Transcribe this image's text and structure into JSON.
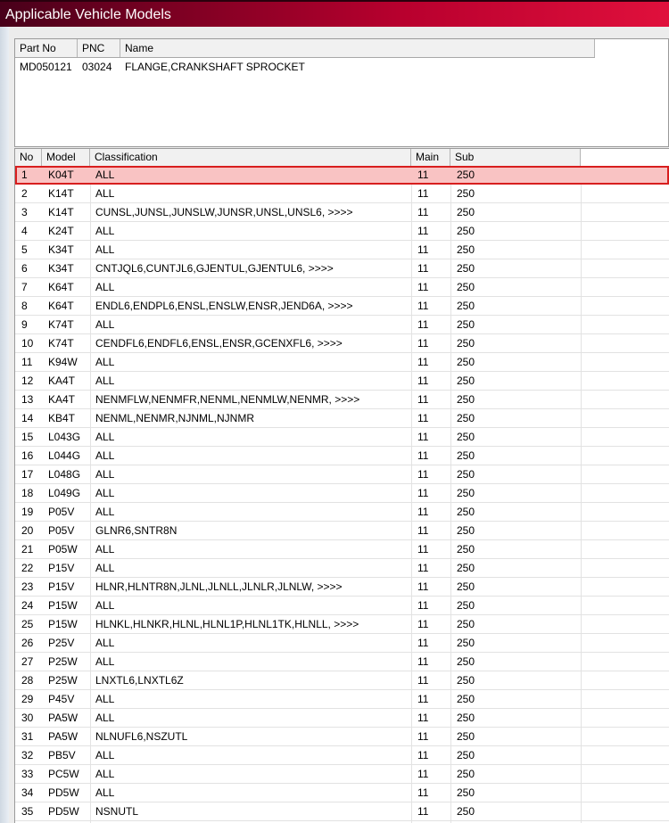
{
  "window": {
    "title": "Applicable Vehicle Models"
  },
  "part": {
    "headers": {
      "part_no": "Part No",
      "pnc": "PNC",
      "name": "Name"
    },
    "row": {
      "part_no": "MD050121",
      "pnc": "03024",
      "name": "FLANGE,CRANKSHAFT SPROCKET"
    }
  },
  "models": {
    "headers": {
      "no": "No",
      "model": "Model",
      "classification": "Classification",
      "main": "Main",
      "sub": "Sub"
    },
    "selected_index": 0,
    "rows": [
      {
        "no": "1",
        "model": "K04T",
        "classification": "ALL",
        "main": "11",
        "sub": "250"
      },
      {
        "no": "2",
        "model": "K14T",
        "classification": "ALL",
        "main": "11",
        "sub": "250"
      },
      {
        "no": "3",
        "model": "K14T",
        "classification": "CUNSL,JUNSL,JUNSLW,JUNSR,UNSL,UNSL6,  >>>>",
        "main": "11",
        "sub": "250"
      },
      {
        "no": "4",
        "model": "K24T",
        "classification": "ALL",
        "main": "11",
        "sub": "250"
      },
      {
        "no": "5",
        "model": "K34T",
        "classification": "ALL",
        "main": "11",
        "sub": "250"
      },
      {
        "no": "6",
        "model": "K34T",
        "classification": "CNTJQL6,CUNTJL6,GJENTUL,GJENTUL6,  >>>>",
        "main": "11",
        "sub": "250"
      },
      {
        "no": "7",
        "model": "K64T",
        "classification": "ALL",
        "main": "11",
        "sub": "250"
      },
      {
        "no": "8",
        "model": "K64T",
        "classification": "ENDL6,ENDPL6,ENSL,ENSLW,ENSR,JEND6A,  >>>>",
        "main": "11",
        "sub": "250"
      },
      {
        "no": "9",
        "model": "K74T",
        "classification": "ALL",
        "main": "11",
        "sub": "250"
      },
      {
        "no": "10",
        "model": "K74T",
        "classification": "CENDFL6,ENDFL6,ENSL,ENSR,GCENXFL6,  >>>>",
        "main": "11",
        "sub": "250"
      },
      {
        "no": "11",
        "model": "K94W",
        "classification": "ALL",
        "main": "11",
        "sub": "250"
      },
      {
        "no": "12",
        "model": "KA4T",
        "classification": "ALL",
        "main": "11",
        "sub": "250"
      },
      {
        "no": "13",
        "model": "KA4T",
        "classification": "NENMFLW,NENMFR,NENML,NENMLW,NENMR,  >>>>",
        "main": "11",
        "sub": "250"
      },
      {
        "no": "14",
        "model": "KB4T",
        "classification": "NENML,NENMR,NJNML,NJNMR",
        "main": "11",
        "sub": "250"
      },
      {
        "no": "15",
        "model": "L043G",
        "classification": "ALL",
        "main": "11",
        "sub": "250"
      },
      {
        "no": "16",
        "model": "L044G",
        "classification": "ALL",
        "main": "11",
        "sub": "250"
      },
      {
        "no": "17",
        "model": "L048G",
        "classification": "ALL",
        "main": "11",
        "sub": "250"
      },
      {
        "no": "18",
        "model": "L049G",
        "classification": "ALL",
        "main": "11",
        "sub": "250"
      },
      {
        "no": "19",
        "model": "P05V",
        "classification": "ALL",
        "main": "11",
        "sub": "250"
      },
      {
        "no": "20",
        "model": "P05V",
        "classification": "GLNR6,SNTR8N",
        "main": "11",
        "sub": "250"
      },
      {
        "no": "21",
        "model": "P05W",
        "classification": "ALL",
        "main": "11",
        "sub": "250"
      },
      {
        "no": "22",
        "model": "P15V",
        "classification": "ALL",
        "main": "11",
        "sub": "250"
      },
      {
        "no": "23",
        "model": "P15V",
        "classification": "HLNR,HLNTR8N,JLNL,JLNLL,JLNLR,JLNLW,  >>>>",
        "main": "11",
        "sub": "250"
      },
      {
        "no": "24",
        "model": "P15W",
        "classification": "ALL",
        "main": "11",
        "sub": "250"
      },
      {
        "no": "25",
        "model": "P15W",
        "classification": "HLNKL,HLNKR,HLNL,HLNL1P,HLNL1TK,HLNLL,  >>>>",
        "main": "11",
        "sub": "250"
      },
      {
        "no": "26",
        "model": "P25V",
        "classification": "ALL",
        "main": "11",
        "sub": "250"
      },
      {
        "no": "27",
        "model": "P25W",
        "classification": "ALL",
        "main": "11",
        "sub": "250"
      },
      {
        "no": "28",
        "model": "P25W",
        "classification": "LNXTL6,LNXTL6Z",
        "main": "11",
        "sub": "250"
      },
      {
        "no": "29",
        "model": "P45V",
        "classification": "ALL",
        "main": "11",
        "sub": "250"
      },
      {
        "no": "30",
        "model": "PA5W",
        "classification": "ALL",
        "main": "11",
        "sub": "250"
      },
      {
        "no": "31",
        "model": "PA5W",
        "classification": "NLNUFL6,NSZUTL",
        "main": "11",
        "sub": "250"
      },
      {
        "no": "32",
        "model": "PB5V",
        "classification": "ALL",
        "main": "11",
        "sub": "250"
      },
      {
        "no": "33",
        "model": "PC5W",
        "classification": "ALL",
        "main": "11",
        "sub": "250"
      },
      {
        "no": "34",
        "model": "PD5W",
        "classification": "ALL",
        "main": "11",
        "sub": "250"
      },
      {
        "no": "35",
        "model": "PD5W",
        "classification": "NSNUTL",
        "main": "11",
        "sub": "250"
      }
    ]
  }
}
